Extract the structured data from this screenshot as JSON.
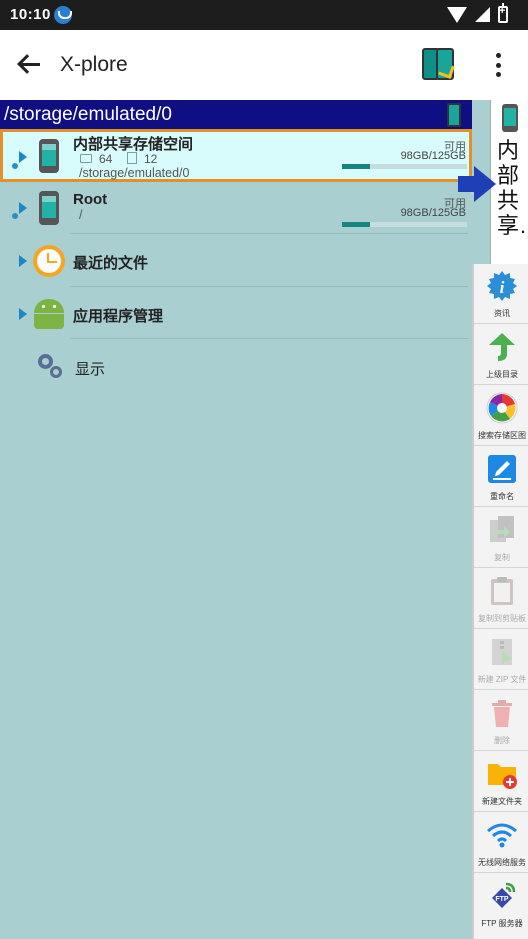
{
  "status": {
    "time": "10:10"
  },
  "appbar": {
    "title": "X-plore"
  },
  "pathbar": {
    "path": "/storage/emulated/0"
  },
  "list": {
    "internal": {
      "title": "内部共享存储空间",
      "folders": "64",
      "files": "12",
      "path": "/storage/emulated/0",
      "free_label": "可用",
      "free": "98GB/125GB",
      "used_fraction": 0.22
    },
    "root": {
      "title": "Root",
      "path": "/",
      "free_label": "可用",
      "free": "98GB/125GB",
      "used_fraction": 0.22
    },
    "recent": {
      "title": "最近的文件"
    },
    "apps": {
      "title": "应用程序管理"
    },
    "display": {
      "title": "显示"
    }
  },
  "preview": {
    "label": "内部共享…"
  },
  "toolbar": {
    "items": [
      {
        "label": "资讯",
        "icon": "info-icon"
      },
      {
        "label": "上级目录",
        "icon": "up-arrow-icon"
      },
      {
        "label": "搜索存储区图",
        "icon": "pie-chart-icon"
      },
      {
        "label": "重命名",
        "icon": "rename-icon"
      },
      {
        "label": "复制",
        "icon": "copy-icon"
      },
      {
        "label": "复制到剪贴板",
        "icon": "clipboard-icon"
      },
      {
        "label": "新建 ZIP 文件",
        "icon": "zip-icon"
      },
      {
        "label": "删除",
        "icon": "trash-icon"
      },
      {
        "label": "新建文件夹",
        "icon": "new-folder-icon"
      },
      {
        "label": "无线网络服务",
        "icon": "wifi-icon"
      },
      {
        "label": "FTP 服务器",
        "icon": "ftp-icon"
      }
    ]
  },
  "colors": {
    "accent": "#0f0f83",
    "selection_border": "#e1902a",
    "teal": "#16857d",
    "panel_bg": "#a9cfd1"
  }
}
